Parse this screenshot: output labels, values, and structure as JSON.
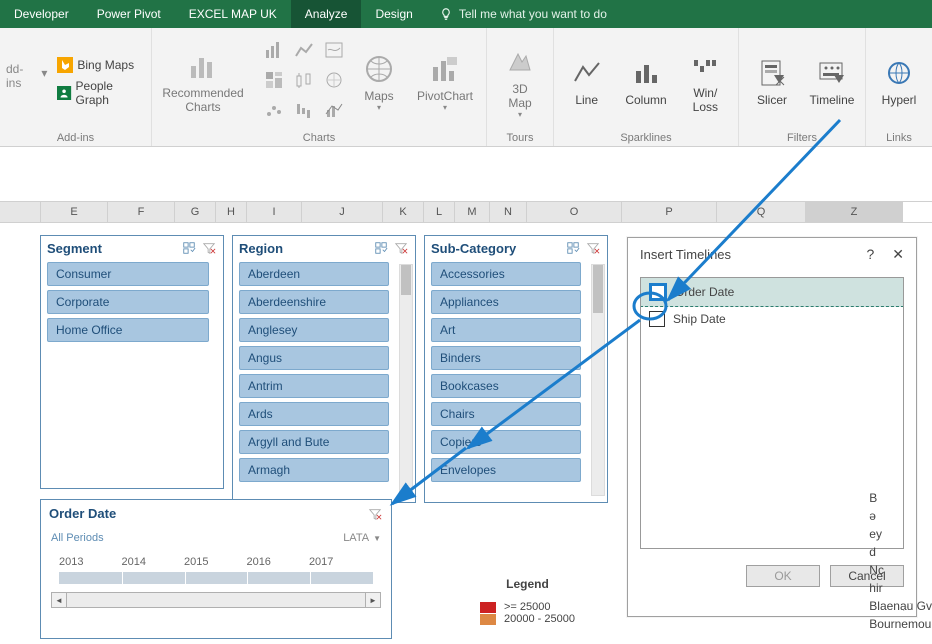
{
  "tabs": {
    "developer": "Developer",
    "powerpivot": "Power Pivot",
    "excelmap": "EXCEL MAP UK",
    "analyze": "Analyze",
    "design": "Design",
    "tellme": "Tell me what you want to do"
  },
  "ribbon": {
    "addins": {
      "prefix": "dd-ins",
      "bing": "Bing Maps",
      "people": "People Graph",
      "group": "Add-ins"
    },
    "charts": {
      "recommended": "Recommended\nCharts",
      "maps": "Maps",
      "pivotchart": "PivotChart",
      "group": "Charts"
    },
    "tours": {
      "map3d": "3D\nMap",
      "group": "Tours"
    },
    "spark": {
      "line": "Line",
      "column": "Column",
      "winloss": "Win/\nLoss",
      "group": "Sparklines"
    },
    "filters": {
      "slicer": "Slicer",
      "timeline": "Timeline",
      "group": "Filters"
    },
    "links": {
      "hyperlink": "Hyperl",
      "group": "Links"
    }
  },
  "columns": [
    "E",
    "F",
    "G",
    "H",
    "I",
    "J",
    "K",
    "L",
    "M",
    "N",
    "O",
    "P",
    "Q",
    "Z"
  ],
  "slicers": {
    "segment": {
      "title": "Segment",
      "items": [
        "Consumer",
        "Corporate",
        "Home Office"
      ]
    },
    "region": {
      "title": "Region",
      "items": [
        "Aberdeen",
        "Aberdeenshire",
        "Anglesey",
        "Angus",
        "Antrim",
        "Ards",
        "Argyll and Bute",
        "Armagh"
      ]
    },
    "subcat": {
      "title": "Sub-Category",
      "items": [
        "Accessories",
        "Appliances",
        "Art",
        "Binders",
        "Bookcases",
        "Chairs",
        "Copiers",
        "Envelopes"
      ]
    }
  },
  "timeline": {
    "title": "Order Date",
    "periods": "All Periods",
    "unit": "LATA",
    "years": [
      "2013",
      "2014",
      "2015",
      "2016",
      "2017"
    ]
  },
  "dialog": {
    "title": "Insert Timelines",
    "items": [
      "Order Date",
      "Ship Date"
    ],
    "ok": "OK",
    "cancel": "Cancel"
  },
  "legend": {
    "title": "Legend",
    "rows": [
      ">=   25000",
      "20000 - 25000"
    ]
  },
  "sidecut": [
    "",
    "",
    "",
    "",
    "B",
    "",
    "ə",
    "ey",
    "",
    "d",
    "Nc",
    "hir",
    "",
    "Blaenau Gv",
    "Bournemou"
  ]
}
